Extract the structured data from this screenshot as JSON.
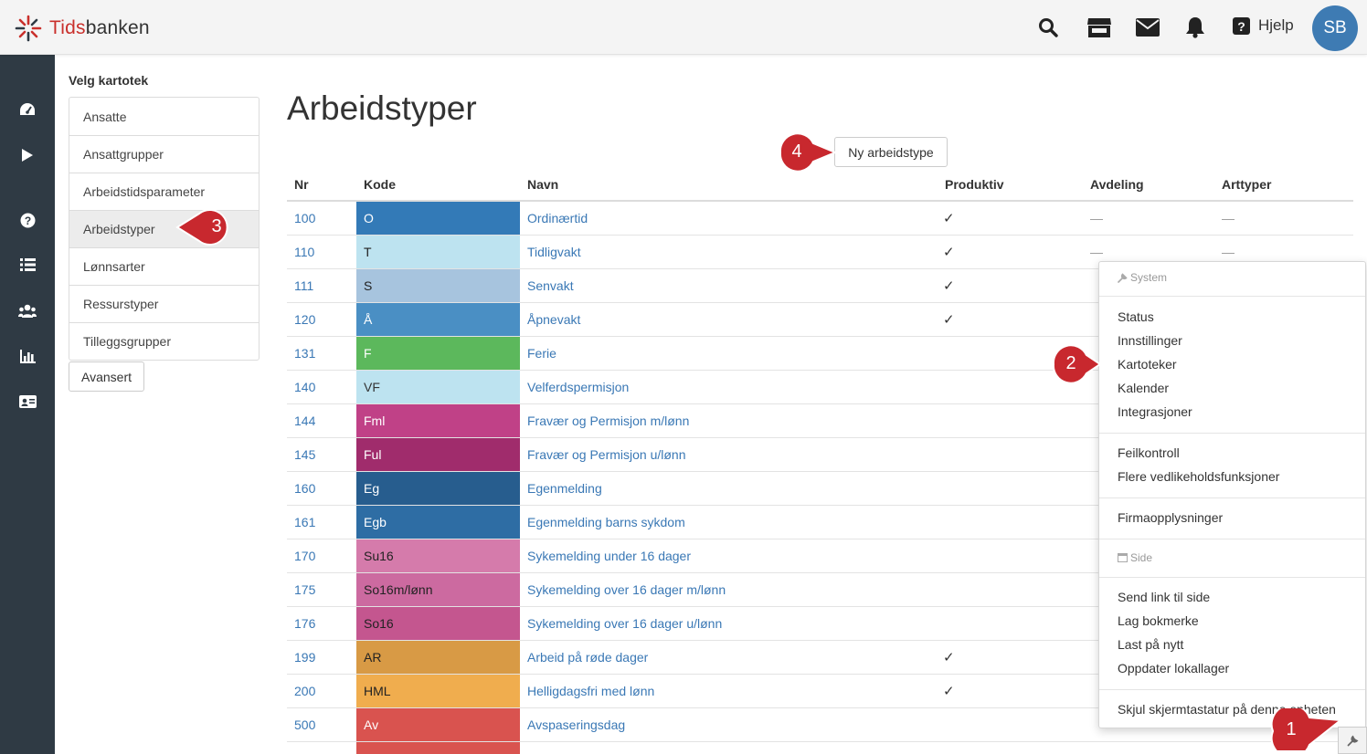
{
  "app": {
    "logo_part1": "Tids",
    "logo_part2": "banken",
    "help_label": "Hjelp",
    "avatar_initials": "SB"
  },
  "sidenav": {
    "icons": [
      "dashboard-icon",
      "play-icon",
      "question-icon",
      "list-icon",
      "users-icon",
      "bar-chart-icon",
      "id-card-icon"
    ]
  },
  "kartotek": {
    "title": "Velg kartotek",
    "items": [
      "Ansatte",
      "Ansattgrupper",
      "Arbeidstidsparameter",
      "Arbeidstyper",
      "Lønnsarter",
      "Ressurstyper",
      "Tilleggsgrupper"
    ],
    "active": "Arbeidstyper",
    "advanced_label": "Avansert"
  },
  "main": {
    "title": "Arbeidstyper",
    "new_button": "Ny arbeidstype"
  },
  "table": {
    "headers": {
      "nr": "Nr",
      "kode": "Kode",
      "navn": "Navn",
      "produktiv": "Produktiv",
      "avdeling": "Avdeling",
      "arttyper": "Arttyper"
    },
    "rows": [
      {
        "nr": "100",
        "kode": "O",
        "color": "#337ab7",
        "text_color": "#ffffff",
        "navn": "Ordinærtid",
        "produktiv": "✓",
        "avdeling": "—",
        "arttyper": "—"
      },
      {
        "nr": "110",
        "kode": "T",
        "color": "#bde3f0",
        "text_color": "#222222",
        "navn": "Tidligvakt",
        "produktiv": "✓",
        "avdeling": "—",
        "arttyper": "—"
      },
      {
        "nr": "111",
        "kode": "S",
        "color": "#a7c4de",
        "text_color": "#222222",
        "navn": "Senvakt",
        "produktiv": "✓",
        "avdeling": "",
        "arttyper": ""
      },
      {
        "nr": "120",
        "kode": "Å",
        "color": "#4a8fc4",
        "text_color": "#ffffff",
        "navn": "Åpnevakt",
        "produktiv": "✓",
        "avdeling": "",
        "arttyper": ""
      },
      {
        "nr": "131",
        "kode": "F",
        "color": "#5cb85c",
        "text_color": "#ffffff",
        "navn": "Ferie",
        "produktiv": "",
        "avdeling": "",
        "arttyper": ""
      },
      {
        "nr": "140",
        "kode": "VF",
        "color": "#bde3f0",
        "text_color": "#333333",
        "navn": "Velferdspermisjon",
        "produktiv": "",
        "avdeling": "",
        "arttyper": ""
      },
      {
        "nr": "144",
        "kode": "Fml",
        "color": "#c04187",
        "text_color": "#ffffff",
        "navn": "Fravær og Permisjon m/lønn",
        "produktiv": "",
        "avdeling": "",
        "arttyper": ""
      },
      {
        "nr": "145",
        "kode": "Ful",
        "color": "#a02c6c",
        "text_color": "#ffffff",
        "navn": "Fravær og Permisjon u/lønn",
        "produktiv": "",
        "avdeling": "",
        "arttyper": ""
      },
      {
        "nr": "160",
        "kode": "Eg",
        "color": "#275d8e",
        "text_color": "#ffffff",
        "navn": "Egenmelding",
        "produktiv": "",
        "avdeling": "",
        "arttyper": ""
      },
      {
        "nr": "161",
        "kode": "Egb",
        "color": "#2e6da4",
        "text_color": "#ffffff",
        "navn": "Egenmelding barns sykdom",
        "produktiv": "",
        "avdeling": "",
        "arttyper": ""
      },
      {
        "nr": "170",
        "kode": "Su16",
        "color": "#d57bab",
        "text_color": "#222222",
        "navn": "Sykemelding under 16 dager",
        "produktiv": "",
        "avdeling": "",
        "arttyper": ""
      },
      {
        "nr": "175",
        "kode": "So16m/lønn",
        "color": "#cc6aa0",
        "text_color": "#222222",
        "navn": "Sykemelding over 16 dager m/lønn",
        "produktiv": "",
        "avdeling": "",
        "arttyper": ""
      },
      {
        "nr": "176",
        "kode": "So16",
        "color": "#c4568f",
        "text_color": "#222222",
        "navn": "Sykemelding over 16 dager u/lønn",
        "produktiv": "",
        "avdeling": "",
        "arttyper": ""
      },
      {
        "nr": "199",
        "kode": "AR",
        "color": "#d89a45",
        "text_color": "#222222",
        "navn": "Arbeid på røde dager",
        "produktiv": "✓",
        "avdeling": "",
        "arttyper": ""
      },
      {
        "nr": "200",
        "kode": "HML",
        "color": "#f0ad4e",
        "text_color": "#222222",
        "navn": "Helligdagsfri med lønn",
        "produktiv": "✓",
        "avdeling": "",
        "arttyper": ""
      },
      {
        "nr": "500",
        "kode": "Av",
        "color": "#d9534f",
        "text_color": "#ffffff",
        "navn": "Avspaseringsdag",
        "produktiv": "",
        "avdeling": "",
        "arttyper": ""
      }
    ]
  },
  "dropdown": {
    "system_header": "System",
    "items_1": [
      "Status",
      "Innstillinger",
      "Kartoteker",
      "Kalender",
      "Integrasjoner"
    ],
    "items_2": [
      "Feilkontroll",
      "Flere vedlikeholdsfunksjoner"
    ],
    "items_3": [
      "Firmaopplysninger"
    ],
    "side_header": "Side",
    "items_4": [
      "Send link til side",
      "Lag bokmerke",
      "Last på nytt",
      "Oppdater lokallager"
    ],
    "items_5": [
      "Skjul skjermtastatur på denne enheten"
    ]
  },
  "callouts": [
    "1",
    "2",
    "3",
    "4"
  ],
  "colors": {
    "brand_red": "#c9302c",
    "link_blue": "#3a78b5",
    "sidebar_dark": "#2f3a44",
    "callout_red": "#c8282e",
    "avatar_blue": "#3e7bb3"
  }
}
